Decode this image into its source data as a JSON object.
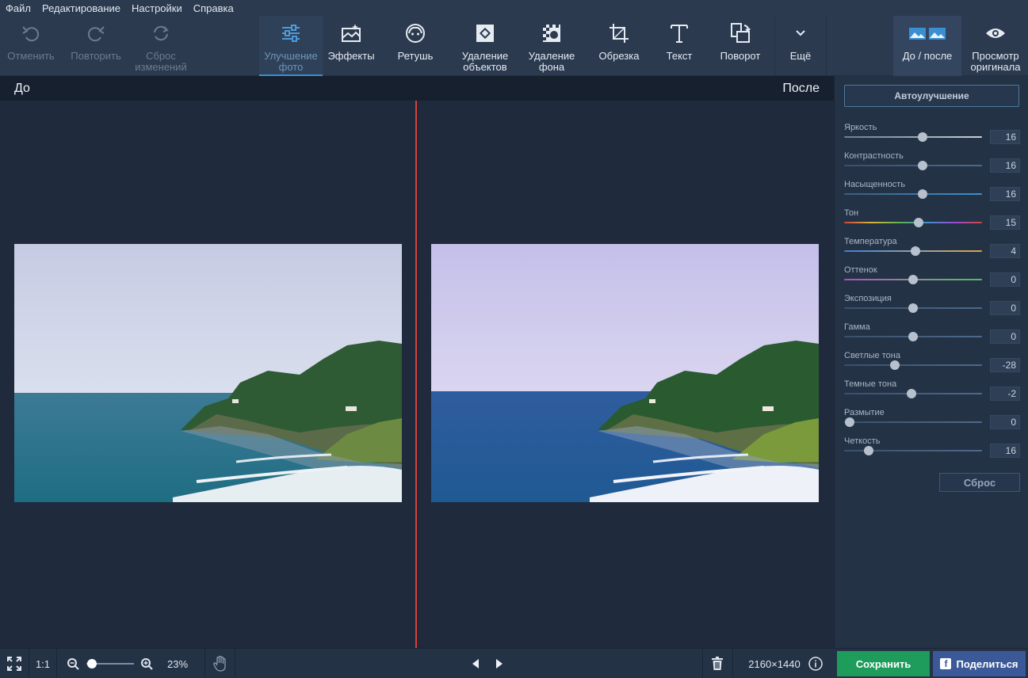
{
  "menu": [
    "Файл",
    "Редактирование",
    "Настройки",
    "Справка"
  ],
  "toolbar": {
    "undo": "Отменить",
    "redo": "Повторить",
    "reset_changes": "Сброс\nизменений",
    "enhance": "Улучшение\nфото",
    "effects": "Эффекты",
    "retouch": "Ретушь",
    "remove_objects": "Удаление\nобъектов",
    "remove_background": "Удаление\nфона",
    "crop": "Обрезка",
    "text": "Текст",
    "rotate": "Поворот",
    "more": "Ещё",
    "before_after": "До / после",
    "view_original": "Просмотр\nоригинала"
  },
  "compare": {
    "before_label": "До",
    "after_label": "После"
  },
  "panel": {
    "auto_button": "Автоулучшение",
    "reset_button": "Сброс",
    "sliders": [
      {
        "name": "Яркость",
        "value": "16",
        "pos": 0.57
      },
      {
        "name": "Контрастность",
        "value": "16",
        "pos": 0.57
      },
      {
        "name": "Насыщенность",
        "value": "16",
        "pos": 0.57
      },
      {
        "name": "Тон",
        "value": "15",
        "pos": 0.54
      },
      {
        "name": "Температура",
        "value": "4",
        "pos": 0.52
      },
      {
        "name": "Оттенок",
        "value": "0",
        "pos": 0.5
      },
      {
        "name": "Экспозиция",
        "value": "0",
        "pos": 0.5
      },
      {
        "name": "Гамма",
        "value": "0",
        "pos": 0.5
      },
      {
        "name": "Светлые тона",
        "value": "-28",
        "pos": 0.37
      },
      {
        "name": "Темные тона",
        "value": "-2",
        "pos": 0.49
      },
      {
        "name": "Размытие",
        "value": "0",
        "pos": 0.04
      },
      {
        "name": "Четкость",
        "value": "16",
        "pos": 0.18
      }
    ]
  },
  "bottom": {
    "fit_icon": "fullscreen-icon",
    "one_to_one": "1:1",
    "zoom": "23%",
    "zoom_level": 0.12,
    "dimensions": "2160×1440",
    "save": "Сохранить",
    "share": "Поделиться"
  },
  "colors": {
    "accent": "#3b8fd0",
    "divider": "#d9413a",
    "save": "#1e9c5b",
    "share": "#3b5998"
  }
}
